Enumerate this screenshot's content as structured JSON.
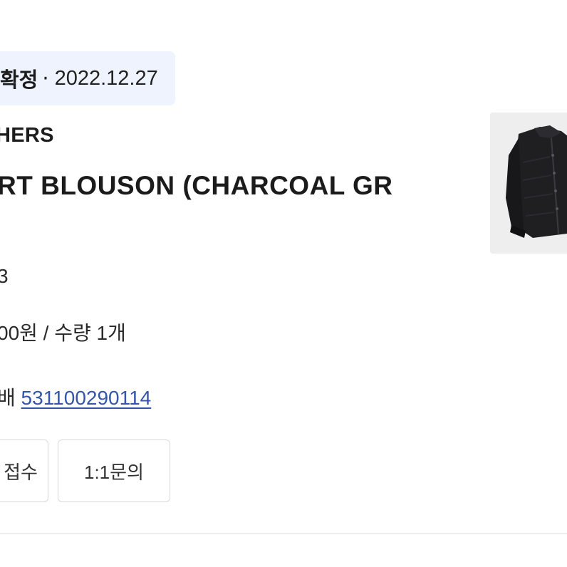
{
  "order": {
    "status": "확정",
    "separator": "·",
    "date": "2022.12.27",
    "brand": "HERS",
    "product_name": "RT BLOUSON (CHARCOAL GR",
    "size_text": "3",
    "price_text": "00원 / 수량 1개",
    "delivery_label": "배",
    "tracking_number": "531100290114"
  },
  "actions": {
    "first_button": "접수",
    "inquiry_button": "1:1문의"
  },
  "thumbnail": {
    "background": "#eeeeef",
    "icon": "jacket-image"
  },
  "colors": {
    "pill_bg": "#eef3fd",
    "link": "#3355aa"
  }
}
